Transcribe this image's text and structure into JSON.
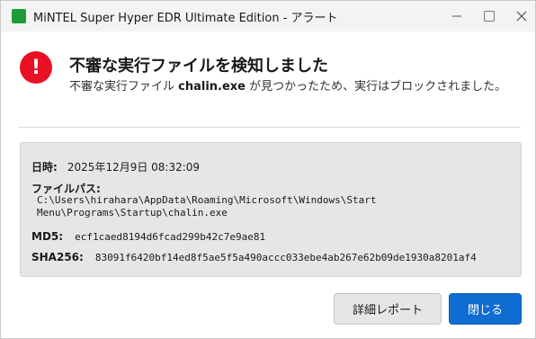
{
  "window": {
    "title": "MiNTEL Super Hyper EDR Ultimate Edition - アラート",
    "app_icon": "green-square-app-icon",
    "controls": [
      "minimize-icon",
      "maximize-icon",
      "close-icon"
    ]
  },
  "alert": {
    "icon_glyph": "!",
    "icon_color": "#e81123",
    "heading": "不審な実行ファイルを検知しました",
    "message_prefix": "不審な実行ファイル ",
    "message_file": "chalin.exe",
    "message_suffix": " が見つかったため、実行はブロックされました。"
  },
  "details": {
    "time_label": "日時:",
    "time_value": "2025年12月9日 08:32:09",
    "path_label": "ファイルパス:",
    "path_value": "C:\\Users\\hirahara\\AppData\\Roaming\\Microsoft\\Windows\\Start Menu\\Programs\\Startup\\chalin.exe",
    "md5_label": "MD5:",
    "md5_value": "ecf1caed8194d6fcad299b42c7e9ae81",
    "sha256_label": "SHA256:",
    "sha256_value": "83091f6420bf14ed8f5ae5f5a490accc033ebe4ab267e62b09de1930a8201af4"
  },
  "buttons": {
    "report_label": "詳細レポート",
    "close_label": "閉じる"
  },
  "colors": {
    "accent": "#0f6cd1",
    "danger": "#e81123",
    "app_icon": "#1e9c3a"
  }
}
